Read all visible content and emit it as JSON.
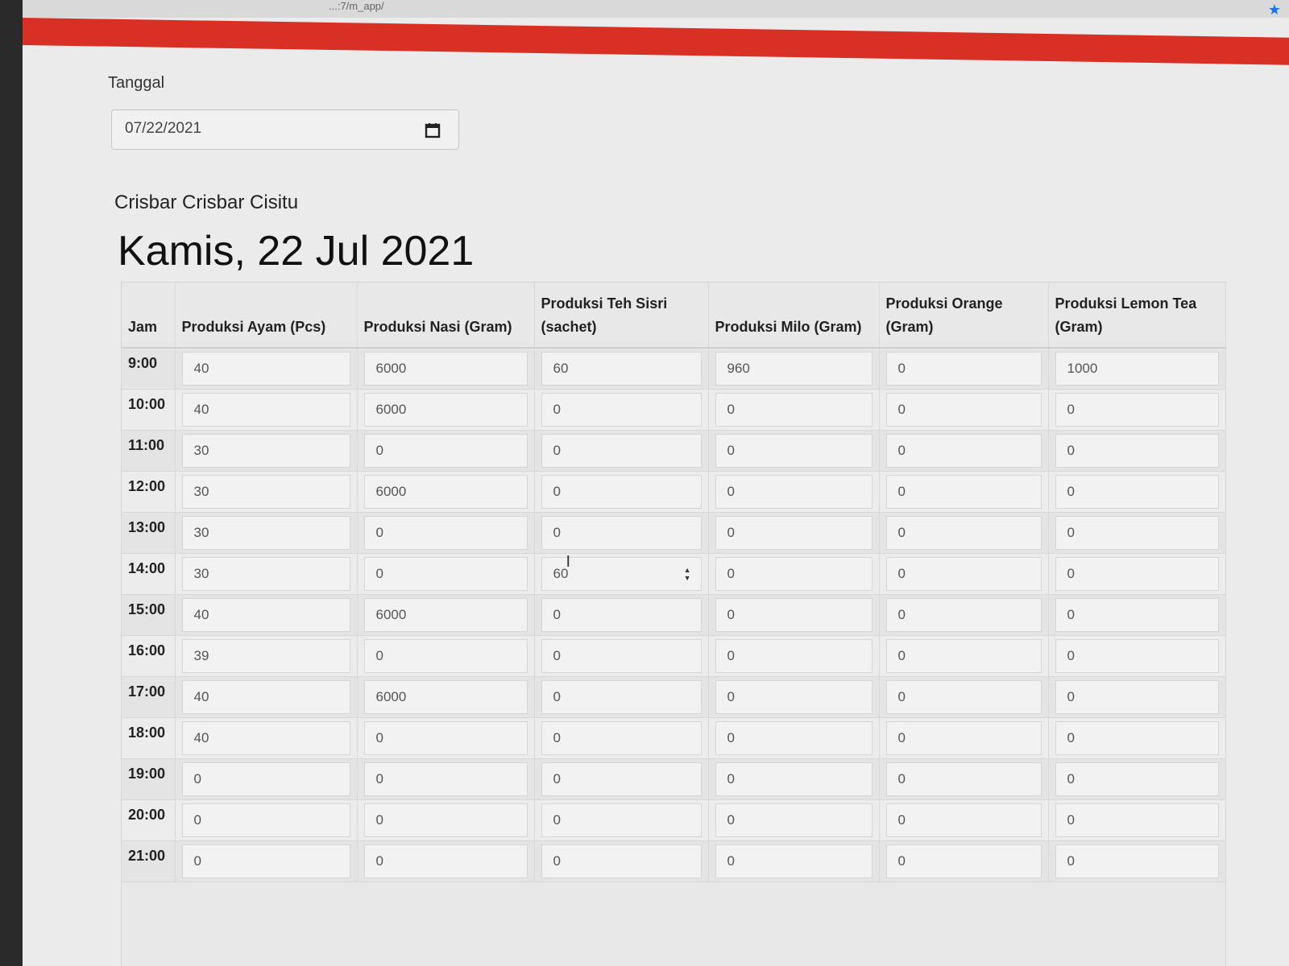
{
  "browser": {
    "url_fragment": "...:7/m_app/",
    "bookmark_icon": "star-icon"
  },
  "form": {
    "date_label": "Tanggal",
    "date_value": "07/22/2021",
    "calendar_icon": "calendar-icon"
  },
  "header": {
    "restaurant_name": "Crisbar Crisbar Cisitu",
    "day_title": "Kamis, 22 Jul 2021"
  },
  "table": {
    "columns": [
      "Jam",
      "Produksi Ayam (Pcs)",
      "Produksi Nasi (Gram)",
      "Produksi Teh Sisri (sachet)",
      "Produksi Milo (Gram)",
      "Produksi Orange (Gram)",
      "Produksi Lemon Tea (Gram)"
    ],
    "rows": [
      {
        "jam": "9:00",
        "values": [
          "40",
          "6000",
          "60",
          "960",
          "0",
          "1000"
        ]
      },
      {
        "jam": "10:00",
        "values": [
          "40",
          "6000",
          "0",
          "0",
          "0",
          "0"
        ]
      },
      {
        "jam": "11:00",
        "values": [
          "30",
          "0",
          "0",
          "0",
          "0",
          "0"
        ]
      },
      {
        "jam": "12:00",
        "values": [
          "30",
          "6000",
          "0",
          "0",
          "0",
          "0"
        ]
      },
      {
        "jam": "13:00",
        "values": [
          "30",
          "0",
          "0",
          "0",
          "0",
          "0"
        ]
      },
      {
        "jam": "14:00",
        "values": [
          "30",
          "0",
          "60",
          "0",
          "0",
          "0"
        ]
      },
      {
        "jam": "15:00",
        "values": [
          "40",
          "6000",
          "0",
          "0",
          "0",
          "0"
        ]
      },
      {
        "jam": "16:00",
        "values": [
          "39",
          "0",
          "0",
          "0",
          "0",
          "0"
        ]
      },
      {
        "jam": "17:00",
        "values": [
          "40",
          "6000",
          "0",
          "0",
          "0",
          "0"
        ]
      },
      {
        "jam": "18:00",
        "values": [
          "40",
          "0",
          "0",
          "0",
          "0",
          "0"
        ]
      },
      {
        "jam": "19:00",
        "values": [
          "0",
          "0",
          "0",
          "0",
          "0",
          "0"
        ]
      },
      {
        "jam": "20:00",
        "values": [
          "0",
          "0",
          "0",
          "0",
          "0",
          "0"
        ]
      },
      {
        "jam": "21:00",
        "values": [
          "0",
          "0",
          "0",
          "0",
          "0",
          "0"
        ]
      }
    ]
  },
  "colors": {
    "header_bar": "#d93025",
    "bookmark": "#1a73e8",
    "page_bg": "#ebebeb"
  }
}
